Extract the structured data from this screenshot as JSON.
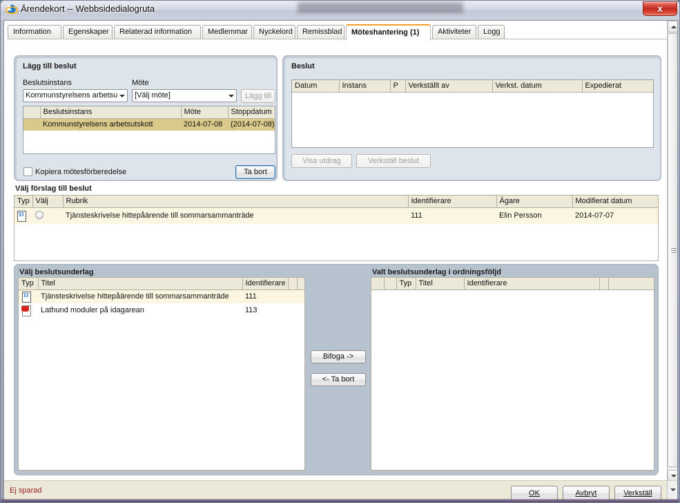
{
  "window": {
    "title": "Ärendekort -- Webbsidedialogruta",
    "app_icon": "internet-explorer-icon",
    "close_label": "x"
  },
  "tabs": [
    {
      "label": "Information",
      "active": false
    },
    {
      "label": "Egenskaper",
      "active": false
    },
    {
      "label": "Relaterad information",
      "active": false
    },
    {
      "label": "Medlemmar",
      "active": false
    },
    {
      "label": "Nyckelord",
      "active": false
    },
    {
      "label": "Remissblad",
      "active": false
    },
    {
      "label": "Möteshantering (1)",
      "active": true
    },
    {
      "label": "Aktiviteter",
      "active": false
    },
    {
      "label": "Logg",
      "active": false
    }
  ],
  "add_decision": {
    "group_label": "Lägg till beslut",
    "instance_label": "Beslutsinstans",
    "instance_value": "Kommunstyrelsens arbetsu",
    "meeting_label": "Möte",
    "meeting_value": "[Välj möte]",
    "add_button": "Lägg till",
    "add_button_disabled": true,
    "grid": {
      "headers": [
        "",
        "Beslutsinstans",
        "Möte",
        "Stoppdatum"
      ],
      "rows": [
        {
          "selected": true,
          "cells": [
            "",
            "Kommunstyrelsens arbetsutskott",
            "2014-07-08",
            "(2014-07-08)"
          ]
        }
      ]
    },
    "copy_checkbox_label": "Kopiera mötesförberedelse",
    "copy_checkbox_checked": false,
    "remove_button": "Ta bort"
  },
  "decision": {
    "group_label": "Beslut",
    "grid": {
      "headers": [
        "Datum",
        "Instans",
        "P",
        "Verkställt av",
        "Verkst. datum",
        "Expedierat"
      ],
      "rows": []
    },
    "show_extract_button": "Visa utdrag",
    "execute_button": "Verkställ beslut",
    "buttons_disabled": true
  },
  "proposal": {
    "section_label": "Välj förslag till beslut",
    "grid": {
      "headers": [
        "Typ",
        "Välj",
        "Rubrik",
        "Identifierare",
        "Ägare",
        "Modifierat datum"
      ],
      "rows": [
        {
          "icon": "document-tj-icon",
          "radio_selected": false,
          "title": "Tjänsteskrivelse hittepåärende till sommarsammanträde",
          "identifier": "111",
          "owner": "Elin Persson",
          "modified": "2014-07-07"
        }
      ]
    }
  },
  "available_documents": {
    "section_label": "Välj beslutsunderlag",
    "grid": {
      "headers": [
        "Typ",
        "Titel",
        "Identifierare",
        "",
        ""
      ],
      "rows": [
        {
          "icon": "document-tj-icon",
          "title": "Tjänsteskrivelse hittepåärende till sommarsammanträde",
          "identifier": "111",
          "highlight": true
        },
        {
          "icon": "pdf-icon",
          "title": "Lathund moduler på idagarean",
          "identifier": "113",
          "highlight": false
        }
      ]
    }
  },
  "transfer_buttons": {
    "attach": "Bifoga ->",
    "remove": "<- Ta bort"
  },
  "selected_documents": {
    "section_label": "Valt beslutsunderlag i ordningsföljd",
    "grid": {
      "headers": [
        "",
        "",
        "Typ",
        "Titel",
        "Identifierare",
        "",
        ""
      ],
      "rows": []
    }
  },
  "statusbar": {
    "status_text": "Ej sparad",
    "buttons": [
      {
        "label": "OK",
        "accel": "O"
      },
      {
        "label": "Avbryt",
        "accel": "A"
      },
      {
        "label": "Verkställ",
        "accel": "V"
      }
    ]
  },
  "colors": {
    "accent_tab": "#f0a024",
    "selected_row": "#d9c98b",
    "soft_row": "#fbf6e2",
    "status_text": "#9a2222",
    "panel": "#c3ccd6",
    "panel_inner": "#dde4ea"
  }
}
